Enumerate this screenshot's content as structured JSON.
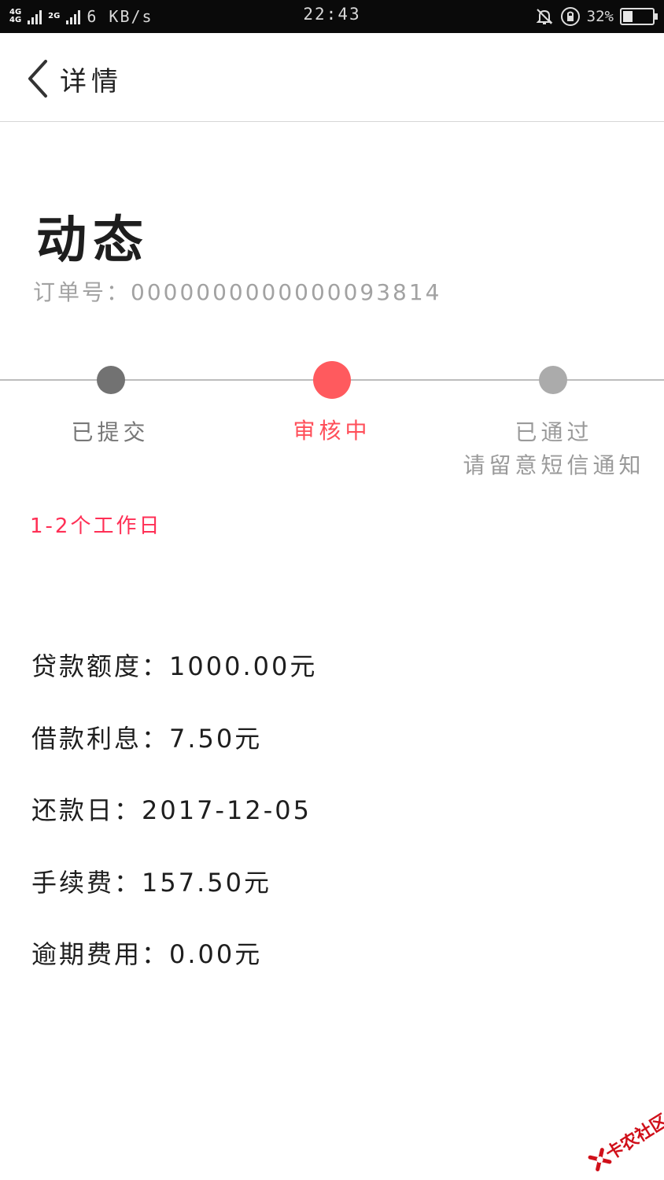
{
  "status_bar": {
    "network_1": "4G",
    "network_2": "4G",
    "network_3": "2G",
    "speed": "6 KB/s",
    "time": "22:43",
    "battery_percent": "32%",
    "battery_level": 0.32,
    "icons": [
      "signal-icon",
      "mute-bell-icon",
      "rotation-lock-icon",
      "battery-icon"
    ]
  },
  "header": {
    "title": "详情",
    "back_icon": "chevron-left-icon"
  },
  "page": {
    "title": "动态",
    "order_label": "订单号：",
    "order_number": "0000000000000093814"
  },
  "progress": {
    "current_step": 2,
    "colors": {
      "done": "#727272",
      "current": "#ff5a5e",
      "pending": "#ababab"
    },
    "steps": [
      {
        "label": "已提交",
        "sublabel": ""
      },
      {
        "label": "审核中",
        "sublabel": ""
      },
      {
        "label": "已通过",
        "sublabel": "请留意短信通知"
      }
    ]
  },
  "eta": "1-2个工作日",
  "details": [
    {
      "label": "贷款额度：",
      "value": "1000.00元"
    },
    {
      "label": "借款利息：",
      "value": "7.50元"
    },
    {
      "label": "还款日：",
      "value": "2017-12-05"
    },
    {
      "label": "手续费：",
      "value": "157.50元"
    },
    {
      "label": "逾期费用：",
      "value": "0.00元"
    }
  ],
  "watermark": {
    "text": "卡农社区",
    "color": "#d0101a"
  }
}
